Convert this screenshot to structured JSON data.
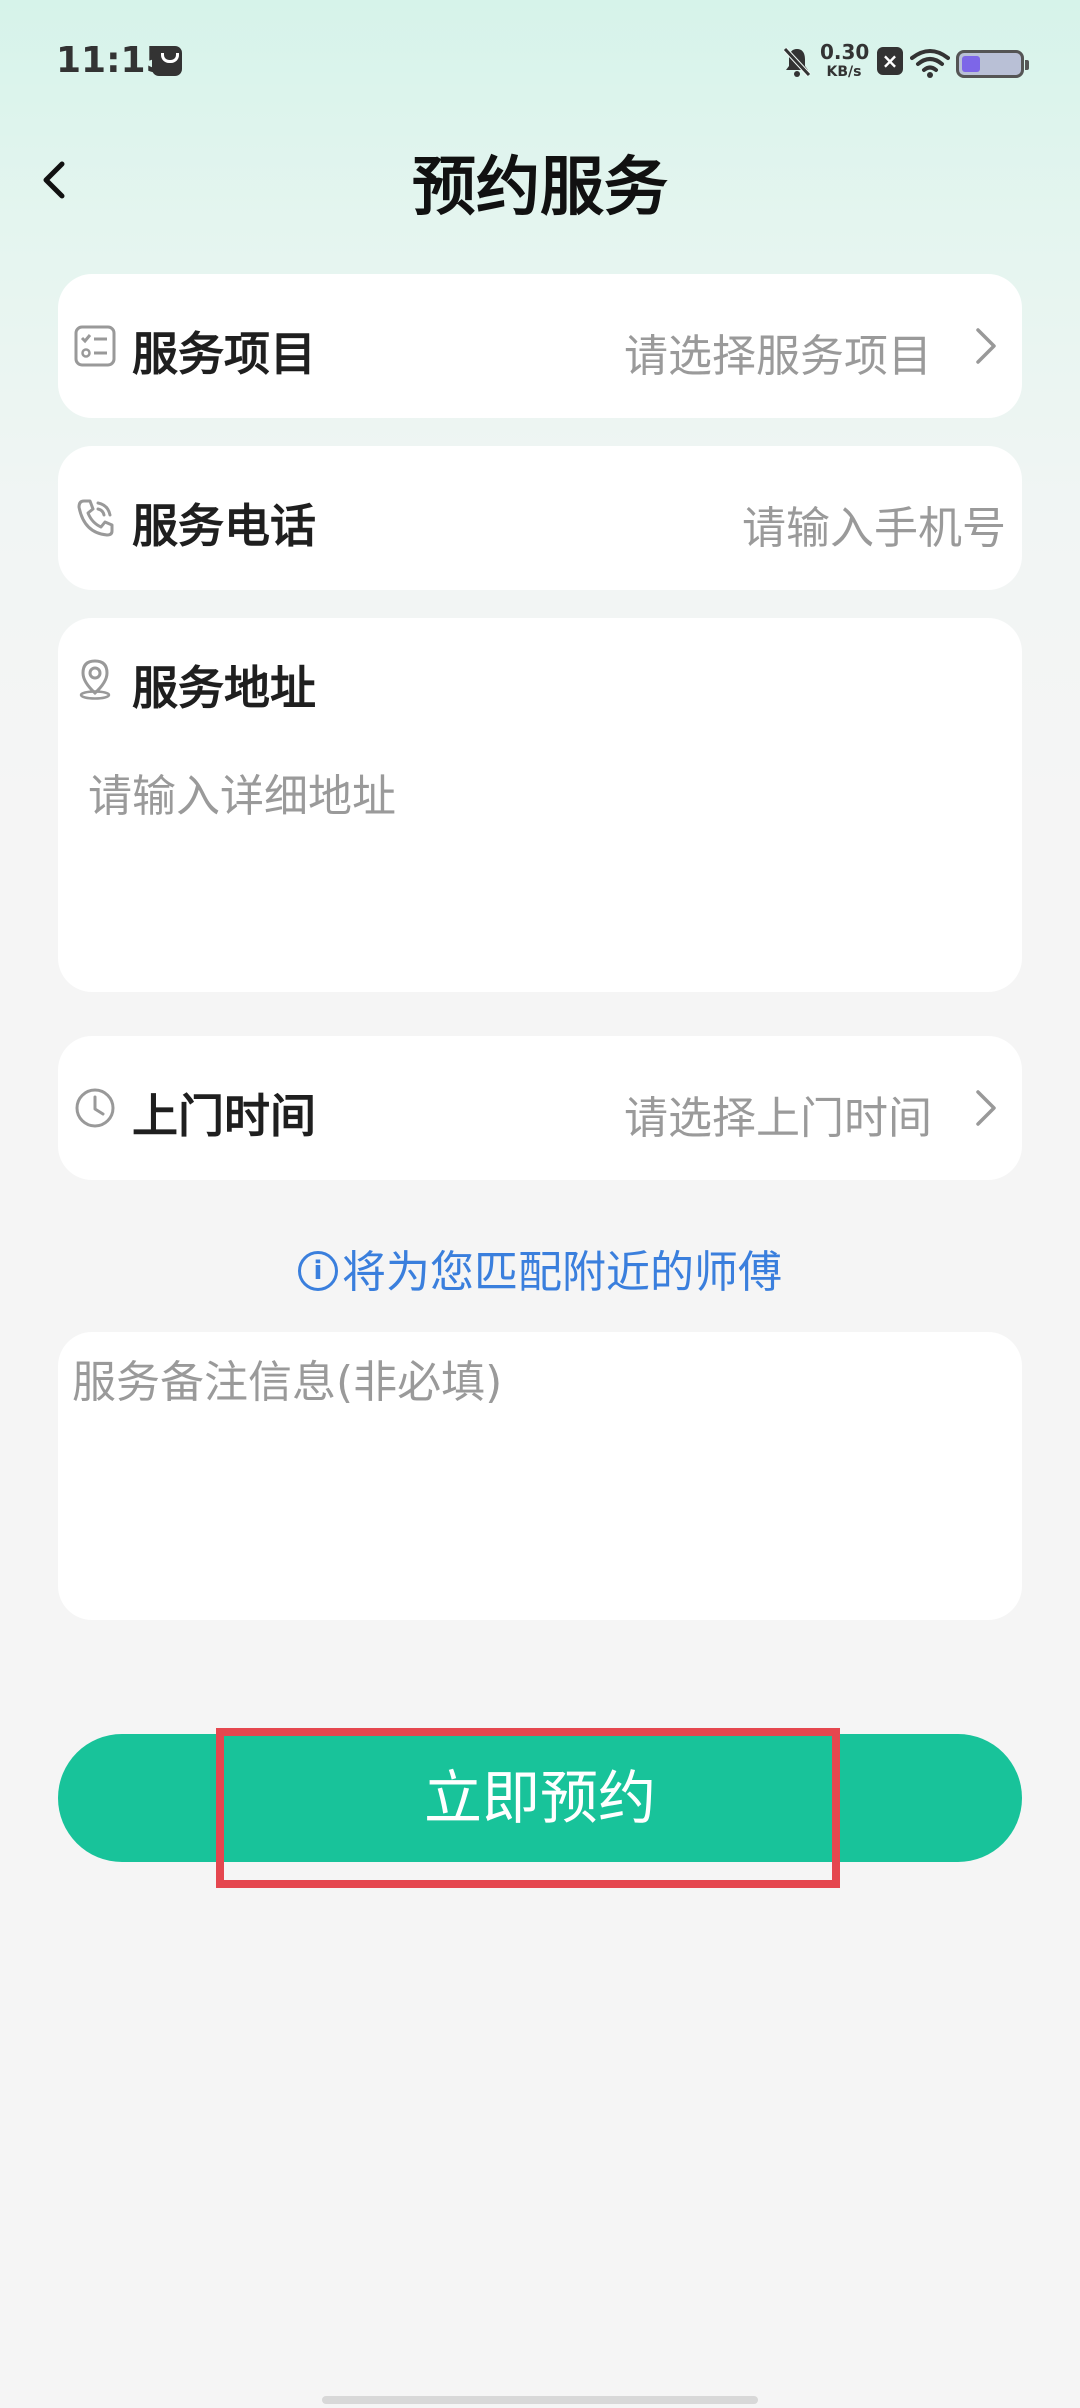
{
  "status_bar": {
    "time": "11:15",
    "net_speed_value": "0.30",
    "net_speed_unit": "KB/s",
    "icons": [
      "shopping-bag-icon",
      "bell-muted-icon",
      "sim-blocked-icon",
      "wifi-icon",
      "battery-icon"
    ]
  },
  "header": {
    "title": "预约服务",
    "back_icon": "chevron-left-icon"
  },
  "form": {
    "service_item": {
      "label": "服务项目",
      "placeholder": "请选择服务项目",
      "icon": "checklist-icon"
    },
    "service_phone": {
      "label": "服务电话",
      "placeholder": "请输入手机号",
      "icon": "phone-icon"
    },
    "service_address": {
      "label": "服务地址",
      "placeholder": "请输入详细地址",
      "icon": "location-pin-icon"
    },
    "visit_time": {
      "label": "上门时间",
      "placeholder": "请选择上门时间",
      "icon": "clock-icon"
    },
    "notice": {
      "icon_glyph": "i",
      "text": "将为您匹配附近的师傅"
    },
    "remark": {
      "placeholder": "服务备注信息(非必填)"
    }
  },
  "submit": {
    "label": "立即预约"
  },
  "colors": {
    "accent_green": "#18c39a",
    "notice_blue": "#3a7fdd",
    "highlight_red": "#e5474f",
    "placeholder_gray": "#9a9a9a"
  }
}
